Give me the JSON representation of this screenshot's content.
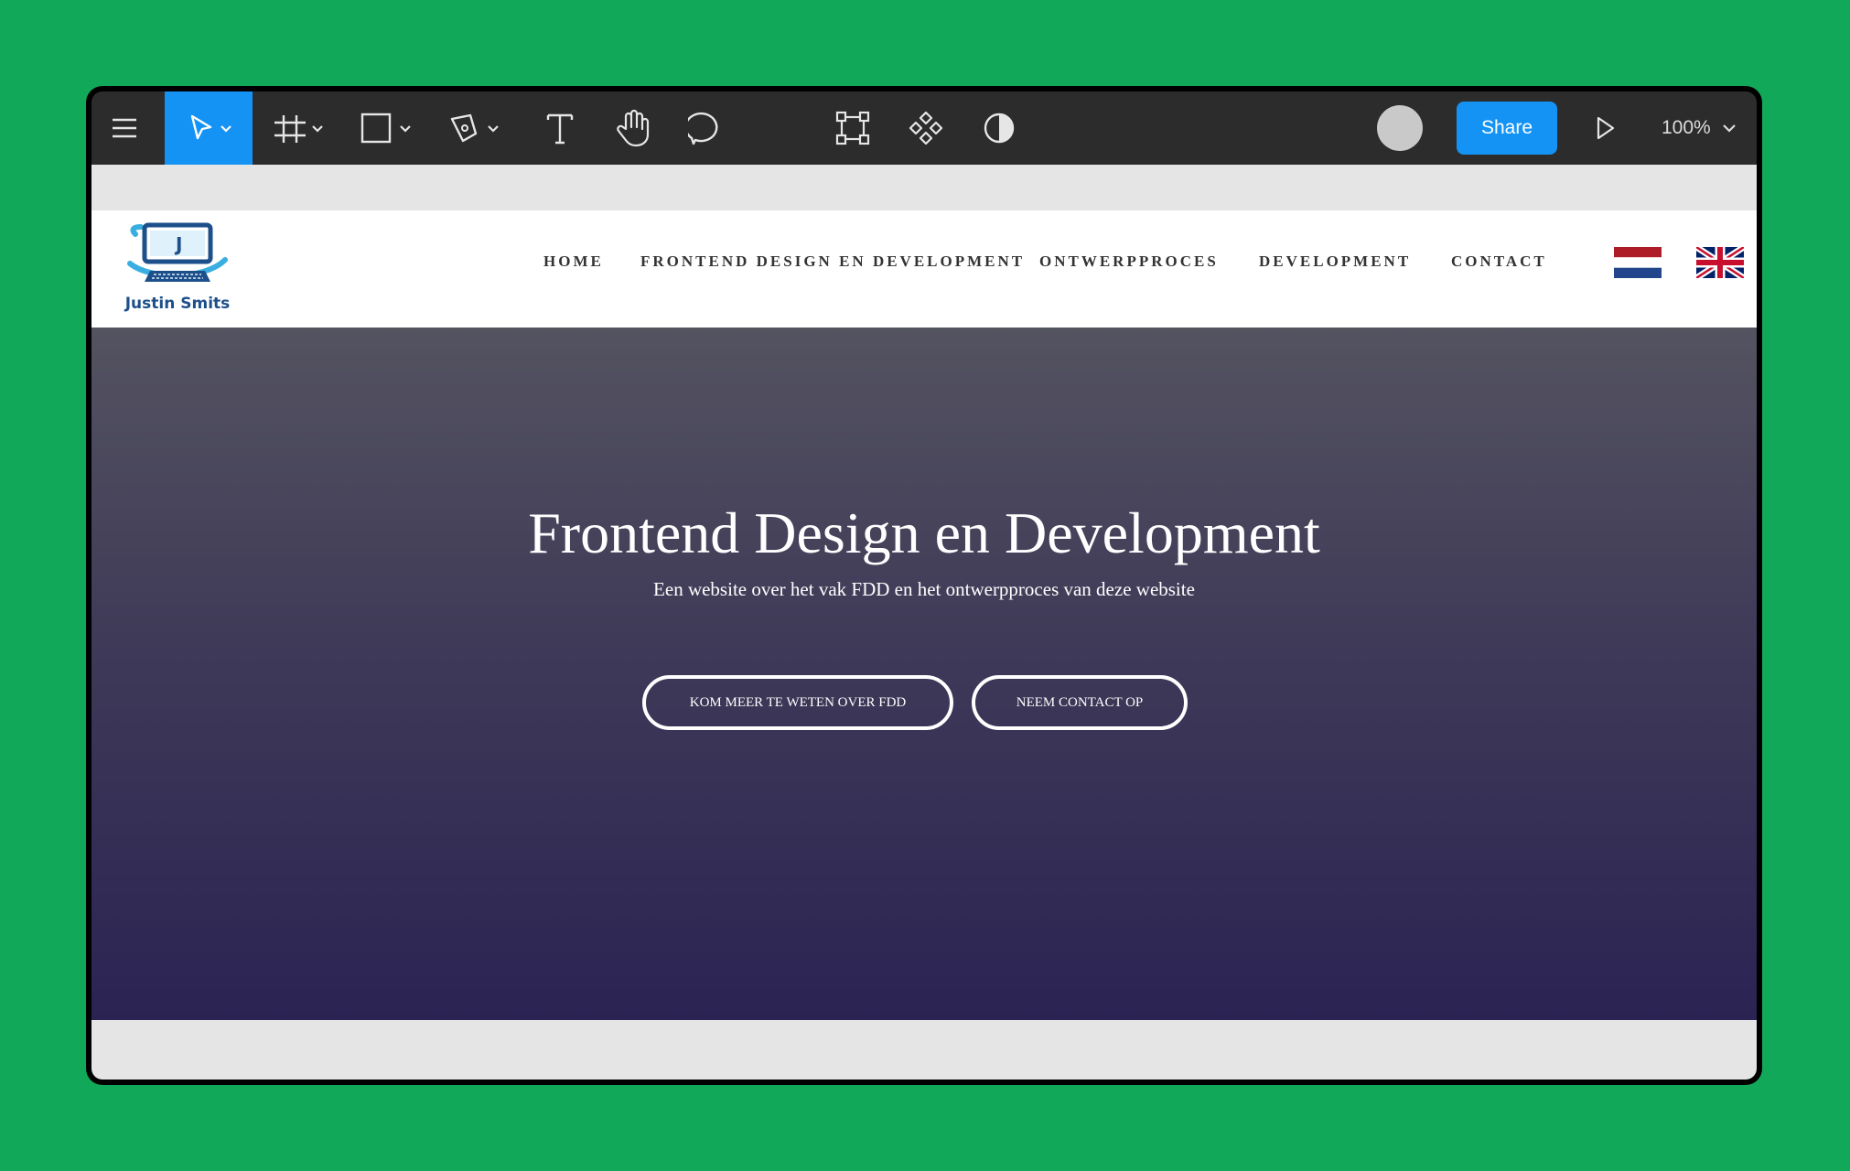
{
  "toolbar": {
    "tools": [
      {
        "name": "menu-icon"
      },
      {
        "name": "move-tool-icon",
        "active": true
      },
      {
        "name": "frame-tool-icon"
      },
      {
        "name": "rectangle-tool-icon"
      },
      {
        "name": "pen-tool-icon"
      },
      {
        "name": "text-tool-icon"
      },
      {
        "name": "hand-tool-icon"
      },
      {
        "name": "comment-tool-icon"
      },
      {
        "name": "transform-icon"
      },
      {
        "name": "component-icon"
      },
      {
        "name": "contrast-icon"
      }
    ],
    "share_label": "Share",
    "zoom_label": "100%",
    "accent_color": "#1593f5"
  },
  "site": {
    "logo_name": "Justin Smits",
    "nav": [
      "HOME",
      "FRONTEND DESIGN EN DEVELOPMENT",
      "ONTWERPPROCES",
      "DEVELOPMENT",
      "CONTACT"
    ],
    "flags": [
      "dutch-flag-icon",
      "uk-flag-icon"
    ],
    "hero": {
      "title": "Frontend Design en Development",
      "subtitle": "Een website over het vak FDD en het ontwerpproces van deze website",
      "buttons": [
        "KOM MEER TE WETEN OVER FDD",
        "NEEM CONTACT OP"
      ]
    }
  }
}
